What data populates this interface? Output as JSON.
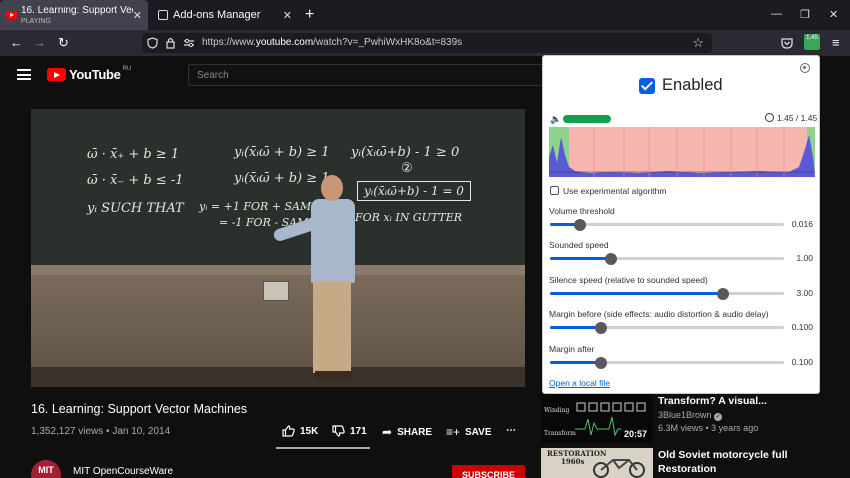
{
  "browser": {
    "tabs": [
      {
        "title": "16. Learning: Support Vector Ma",
        "status": "PLAYING"
      },
      {
        "title": "Add-ons Manager"
      }
    ],
    "url_prefix": "https://www.",
    "url_host": "youtube.com",
    "url_path": "/watch?v=_PwhiWxHK8o&t=839s"
  },
  "youtube": {
    "logo": "YouTube",
    "region": "RU",
    "search_placeholder": "Search"
  },
  "blackboard": {
    "lines": [
      "ω̄ · x̄₊ + b ≥ 1",
      "ω̄ · x̄₋ + b ≤ -1",
      "yᵢ SUCH THAT",
      "yᵢ(x̄ᵢω̄ + b) ≥ 1",
      "yᵢ(x̄ᵢω̄ + b) ≥ 1",
      "yᵢ(x̄ᵢω̄+b) - 1 ≥ 0",
      "yᵢ = +1 FOR + SAMPLES",
      "= -1 FOR - SAMPLES",
      "yᵢ(x̄ᵢω̄+b) - 1 = 0",
      "FOR xᵢ IN GUTTER",
      "②"
    ]
  },
  "video": {
    "title": "16. Learning: Support Vector Machines",
    "views": "1,352,127 views",
    "date": "Jan 10, 2014",
    "likes": "15K",
    "dislikes": "171",
    "share_label": "SHARE",
    "save_label": "SAVE",
    "more_label": "⋯",
    "channel_name": "MIT OpenCourseWare",
    "channel_avatar_text": "MIT",
    "subscribe_label": "SUBSCRIBE"
  },
  "recommendations": [
    {
      "title_line": "Transform? A visual...",
      "channel": "3Blue1Brown",
      "views": "6.3M views",
      "age": "3 years ago",
      "duration": "20:57",
      "thumb_labels": [
        "Winding",
        "Transform"
      ]
    },
    {
      "title_line1": "Old Soviet motorcycle full",
      "title_line2": "Restoration",
      "thumb_labels": [
        "RESTORATION",
        "1960s"
      ]
    }
  ],
  "popup": {
    "enabled_label": "Enabled",
    "enabled": true,
    "speed_readout": "1.45 / 1.45",
    "experimental_label": "Use experimental algorithm",
    "experimental": false,
    "sliders": [
      {
        "label": "Volume threshold",
        "value": "0.016",
        "fraction": 0.13
      },
      {
        "label": "Sounded speed",
        "value": "1.00",
        "fraction": 0.26
      },
      {
        "label": "Silence speed (relative to sounded speed)",
        "value": "3.00",
        "fraction": 0.74
      },
      {
        "label": "Margin before (side effects: audio distortion & audio delay)",
        "value": "0.100",
        "fraction": 0.22
      },
      {
        "label": "Margin after",
        "value": "0.100",
        "fraction": 0.22
      }
    ],
    "local_file_label": "Open a local file",
    "extension_badge": "1.45"
  },
  "colors": {
    "accent": "#0060df",
    "graph_bg": "#f7b5b0",
    "graph_green": "#8fd18f",
    "volume_meter": "#10a050",
    "subscribe": "#cc0000"
  }
}
